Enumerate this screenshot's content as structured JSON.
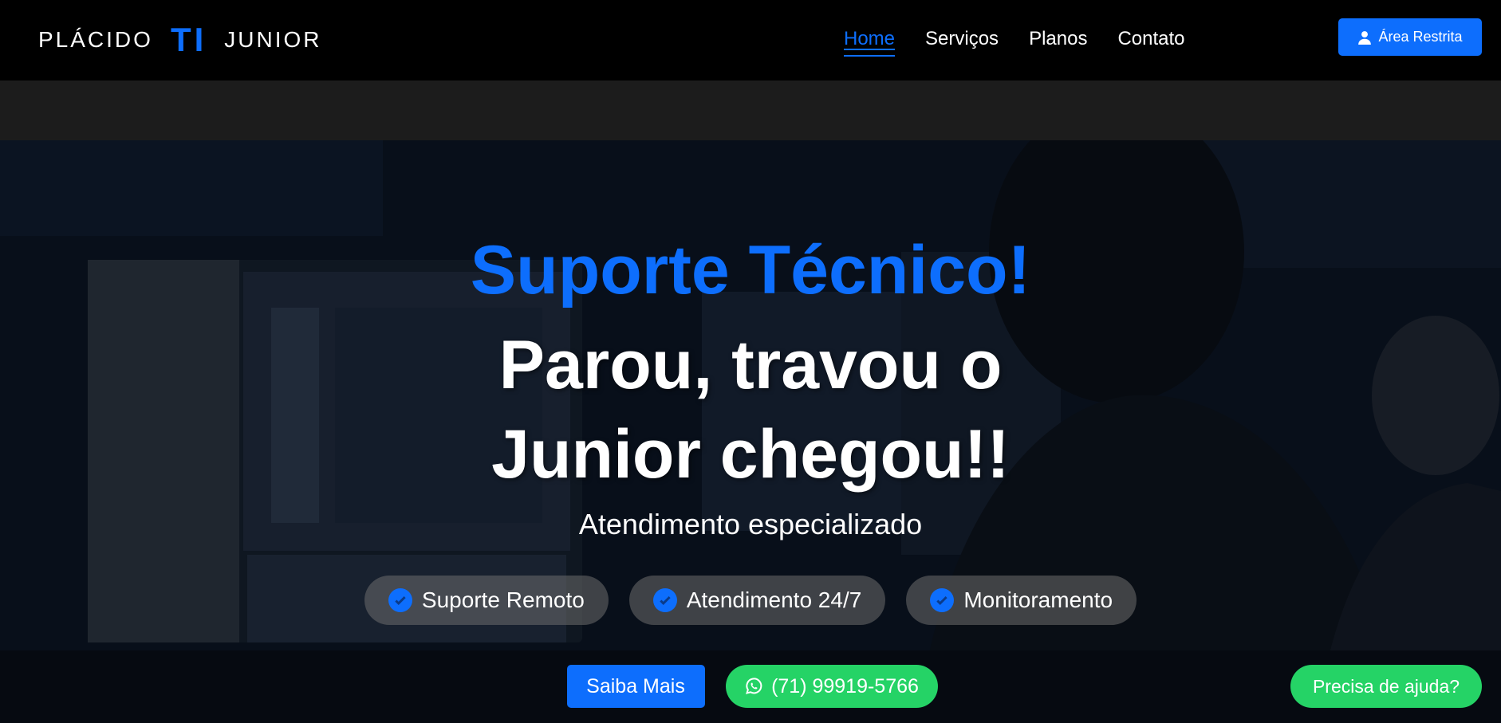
{
  "navbar": {
    "logo": {
      "left_text": "PLÁCIDO",
      "mid_text": "TI",
      "right_text": "JUNIOR"
    },
    "links": [
      {
        "label": "Home",
        "active": true
      },
      {
        "label": "Serviços",
        "active": false
      },
      {
        "label": "Planos",
        "active": false
      },
      {
        "label": "Contato",
        "active": false
      }
    ],
    "restrita_button": {
      "label": "Área Restrita",
      "icon": "user-icon"
    }
  },
  "hero": {
    "title": "Suporte Técnico!",
    "heading_line1": "Parou, travou o",
    "heading_line2": "Junior chegou!!",
    "subtitle": "Atendimento especializado",
    "features": [
      {
        "label": "Suporte Remoto",
        "icon": "check-circle-icon"
      },
      {
        "label": "Atendimento 24/7",
        "icon": "check-circle-icon"
      },
      {
        "label": "Monitoramento",
        "icon": "check-circle-icon"
      }
    ],
    "cta": {
      "saiba_label": "Saiba Mais",
      "whatsapp_label": "(71) 99919-5766",
      "whatsapp_icon": "whatsapp-icon"
    }
  },
  "help_button": {
    "label": "Precisa de ajuda?"
  },
  "colors": {
    "accent": "#0d6efd",
    "whatsapp": "#25d366",
    "navbar_bg": "#000000",
    "band_bg": "#1c1c1c"
  }
}
